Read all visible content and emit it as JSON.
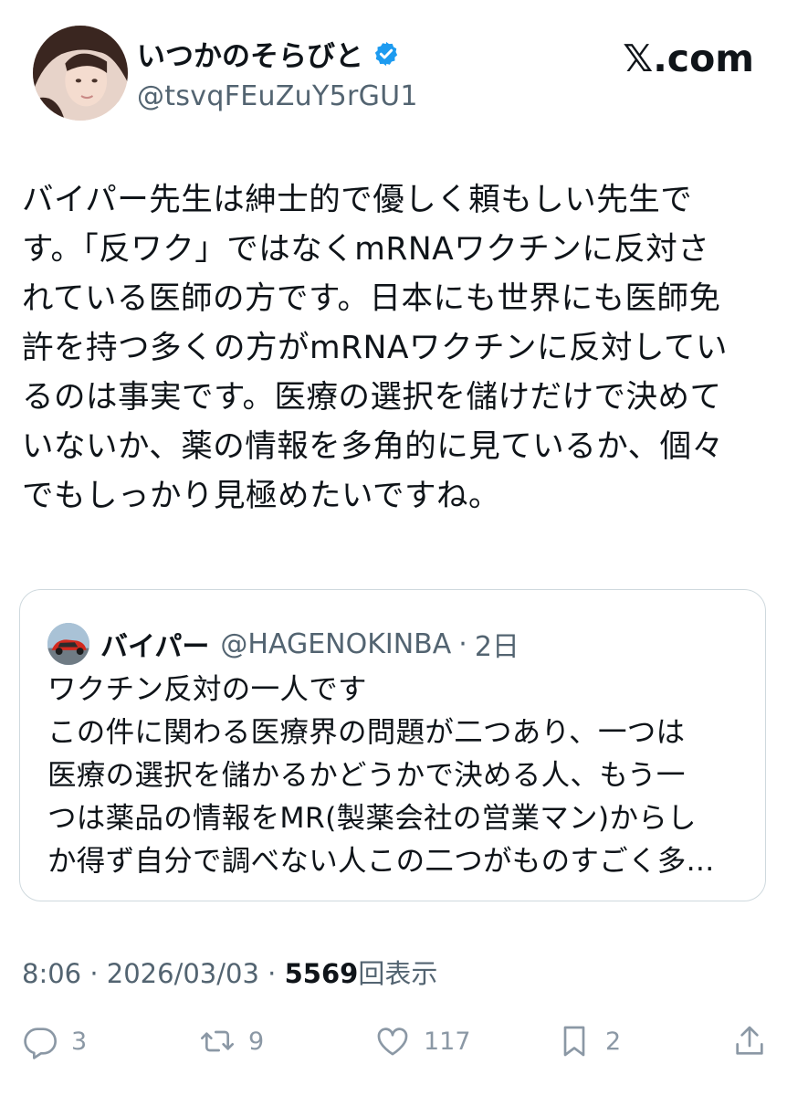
{
  "header": {
    "display_name": "いつかのそらびと",
    "handle": "@tsvqFEuZuY5rGU1",
    "brand": "𝕏.com",
    "verified_icon": "verified-badge-icon",
    "verified_color": "#1d9bf0"
  },
  "tweet": {
    "lines": [
      "バイパー先生は紳士的で優しく頼もしい先生で",
      "す。「反ワク」ではなくmRNAワクチンに反対さ",
      "れている医師の方です。日本にも世界にも医師免",
      "許を持つ多くの方がmRNAワクチンに反対してい",
      "るのは事実です。医療の選択を儲けだけで決めて",
      "いないか、薬の情報を多角的に見ているか、個々",
      "でもしっかり見極めたいですね。"
    ]
  },
  "quote": {
    "name": "バイパー",
    "handle": "@HAGENOKINBA",
    "separator": "·",
    "time": "2日",
    "lines": [
      "ワクチン反対の一人です",
      "この件に関わる医療界の問題が二つあり、一つは",
      "医療の選択を儲かるかどうかで決める人、もう一",
      "つは薬品の情報をMR(製薬会社の営業マン)からし",
      "か得ず自分で調べない人この二つがものすごく多..."
    ]
  },
  "meta": {
    "time": "8:06",
    "sep1": "·",
    "date": "2026/03/03",
    "sep2": "·",
    "views": "5569",
    "views_label": "回表示"
  },
  "actions": {
    "replies": "3",
    "reposts": "9",
    "likes": "117",
    "bookmarks": "2",
    "icons": [
      "reply-icon",
      "repost-icon",
      "like-icon",
      "bookmark-icon",
      "share-icon"
    ]
  },
  "colors": {
    "text": "#0f1419",
    "secondary": "#536471",
    "border": "#cfd9de",
    "action_gray": "#8b98a5"
  }
}
